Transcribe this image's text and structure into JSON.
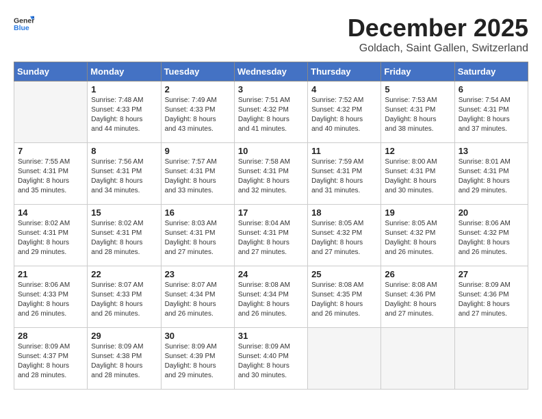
{
  "header": {
    "logo_general": "General",
    "logo_blue": "Blue",
    "month_title": "December 2025",
    "location": "Goldach, Saint Gallen, Switzerland"
  },
  "weekdays": [
    "Sunday",
    "Monday",
    "Tuesday",
    "Wednesday",
    "Thursday",
    "Friday",
    "Saturday"
  ],
  "weeks": [
    [
      {
        "day": "",
        "info": ""
      },
      {
        "day": "1",
        "info": "Sunrise: 7:48 AM\nSunset: 4:33 PM\nDaylight: 8 hours\nand 44 minutes."
      },
      {
        "day": "2",
        "info": "Sunrise: 7:49 AM\nSunset: 4:33 PM\nDaylight: 8 hours\nand 43 minutes."
      },
      {
        "day": "3",
        "info": "Sunrise: 7:51 AM\nSunset: 4:32 PM\nDaylight: 8 hours\nand 41 minutes."
      },
      {
        "day": "4",
        "info": "Sunrise: 7:52 AM\nSunset: 4:32 PM\nDaylight: 8 hours\nand 40 minutes."
      },
      {
        "day": "5",
        "info": "Sunrise: 7:53 AM\nSunset: 4:31 PM\nDaylight: 8 hours\nand 38 minutes."
      },
      {
        "day": "6",
        "info": "Sunrise: 7:54 AM\nSunset: 4:31 PM\nDaylight: 8 hours\nand 37 minutes."
      }
    ],
    [
      {
        "day": "7",
        "info": "Sunrise: 7:55 AM\nSunset: 4:31 PM\nDaylight: 8 hours\nand 35 minutes."
      },
      {
        "day": "8",
        "info": "Sunrise: 7:56 AM\nSunset: 4:31 PM\nDaylight: 8 hours\nand 34 minutes."
      },
      {
        "day": "9",
        "info": "Sunrise: 7:57 AM\nSunset: 4:31 PM\nDaylight: 8 hours\nand 33 minutes."
      },
      {
        "day": "10",
        "info": "Sunrise: 7:58 AM\nSunset: 4:31 PM\nDaylight: 8 hours\nand 32 minutes."
      },
      {
        "day": "11",
        "info": "Sunrise: 7:59 AM\nSunset: 4:31 PM\nDaylight: 8 hours\nand 31 minutes."
      },
      {
        "day": "12",
        "info": "Sunrise: 8:00 AM\nSunset: 4:31 PM\nDaylight: 8 hours\nand 30 minutes."
      },
      {
        "day": "13",
        "info": "Sunrise: 8:01 AM\nSunset: 4:31 PM\nDaylight: 8 hours\nand 29 minutes."
      }
    ],
    [
      {
        "day": "14",
        "info": "Sunrise: 8:02 AM\nSunset: 4:31 PM\nDaylight: 8 hours\nand 29 minutes."
      },
      {
        "day": "15",
        "info": "Sunrise: 8:02 AM\nSunset: 4:31 PM\nDaylight: 8 hours\nand 28 minutes."
      },
      {
        "day": "16",
        "info": "Sunrise: 8:03 AM\nSunset: 4:31 PM\nDaylight: 8 hours\nand 27 minutes."
      },
      {
        "day": "17",
        "info": "Sunrise: 8:04 AM\nSunset: 4:31 PM\nDaylight: 8 hours\nand 27 minutes."
      },
      {
        "day": "18",
        "info": "Sunrise: 8:05 AM\nSunset: 4:32 PM\nDaylight: 8 hours\nand 27 minutes."
      },
      {
        "day": "19",
        "info": "Sunrise: 8:05 AM\nSunset: 4:32 PM\nDaylight: 8 hours\nand 26 minutes."
      },
      {
        "day": "20",
        "info": "Sunrise: 8:06 AM\nSunset: 4:32 PM\nDaylight: 8 hours\nand 26 minutes."
      }
    ],
    [
      {
        "day": "21",
        "info": "Sunrise: 8:06 AM\nSunset: 4:33 PM\nDaylight: 8 hours\nand 26 minutes."
      },
      {
        "day": "22",
        "info": "Sunrise: 8:07 AM\nSunset: 4:33 PM\nDaylight: 8 hours\nand 26 minutes."
      },
      {
        "day": "23",
        "info": "Sunrise: 8:07 AM\nSunset: 4:34 PM\nDaylight: 8 hours\nand 26 minutes."
      },
      {
        "day": "24",
        "info": "Sunrise: 8:08 AM\nSunset: 4:34 PM\nDaylight: 8 hours\nand 26 minutes."
      },
      {
        "day": "25",
        "info": "Sunrise: 8:08 AM\nSunset: 4:35 PM\nDaylight: 8 hours\nand 26 minutes."
      },
      {
        "day": "26",
        "info": "Sunrise: 8:08 AM\nSunset: 4:36 PM\nDaylight: 8 hours\nand 27 minutes."
      },
      {
        "day": "27",
        "info": "Sunrise: 8:09 AM\nSunset: 4:36 PM\nDaylight: 8 hours\nand 27 minutes."
      }
    ],
    [
      {
        "day": "28",
        "info": "Sunrise: 8:09 AM\nSunset: 4:37 PM\nDaylight: 8 hours\nand 28 minutes."
      },
      {
        "day": "29",
        "info": "Sunrise: 8:09 AM\nSunset: 4:38 PM\nDaylight: 8 hours\nand 28 minutes."
      },
      {
        "day": "30",
        "info": "Sunrise: 8:09 AM\nSunset: 4:39 PM\nDaylight: 8 hours\nand 29 minutes."
      },
      {
        "day": "31",
        "info": "Sunrise: 8:09 AM\nSunset: 4:40 PM\nDaylight: 8 hours\nand 30 minutes."
      },
      {
        "day": "",
        "info": ""
      },
      {
        "day": "",
        "info": ""
      },
      {
        "day": "",
        "info": ""
      }
    ]
  ]
}
